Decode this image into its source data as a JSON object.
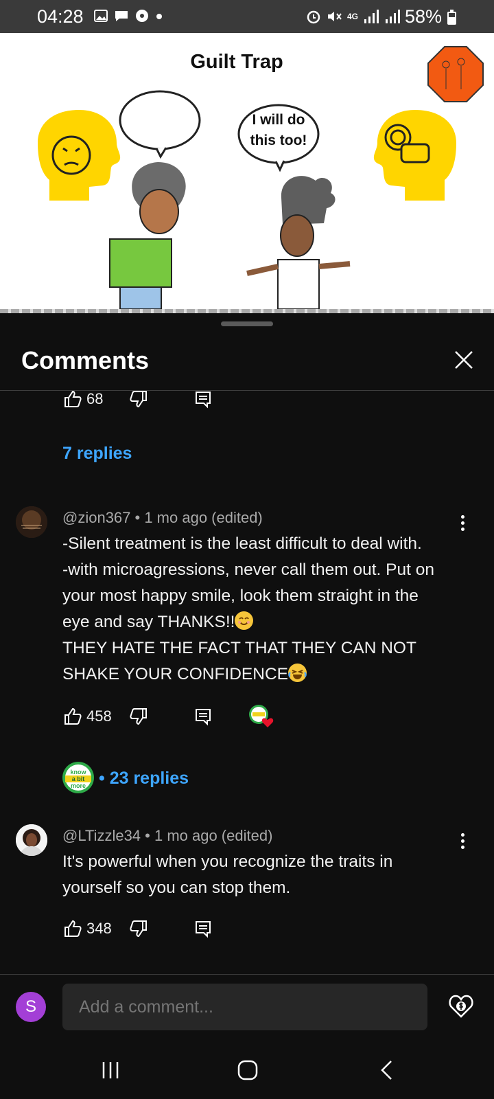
{
  "status_bar": {
    "time": "04:28",
    "battery": "58%",
    "network": "4G"
  },
  "video": {
    "title": "Guilt Trap",
    "speech_bubble_woman": [
      "I will do",
      "this too!"
    ]
  },
  "comments_panel": {
    "title": "Comments",
    "prev_thread": {
      "like_count": "68",
      "replies_label": "7 replies"
    },
    "comments": [
      {
        "author": "@zion367",
        "meta": "@zion367 • 1 mo ago (edited)",
        "lines": [
          "-Silent treatment is the least difficult to deal with.",
          "-with microagressions, never call them out. Put on",
          "your most happy smile, look them straight in the",
          "eye and say THANKS!!",
          "THEY HATE THE FACT THAT THEY CAN NOT",
          "SHAKE YOUR CONFIDENCE"
        ],
        "like_count": "458",
        "creator_badge_text": [
          "know",
          "a bit",
          "more"
        ],
        "replies_label": "• 23 replies"
      },
      {
        "author": "@LTizzle34",
        "meta": "@LTizzle34 • 1 mo ago (edited)",
        "lines": [
          "It's powerful when you recognize the traits in",
          "yourself so you can stop them."
        ],
        "like_count": "348"
      }
    ]
  },
  "add_comment": {
    "avatar_letter": "S",
    "placeholder": "Add a comment..."
  },
  "colors": {
    "link_blue": "#3ea6ff",
    "avatar_purple": "#a33fd6",
    "sheet_bg": "#0f0f0f"
  }
}
